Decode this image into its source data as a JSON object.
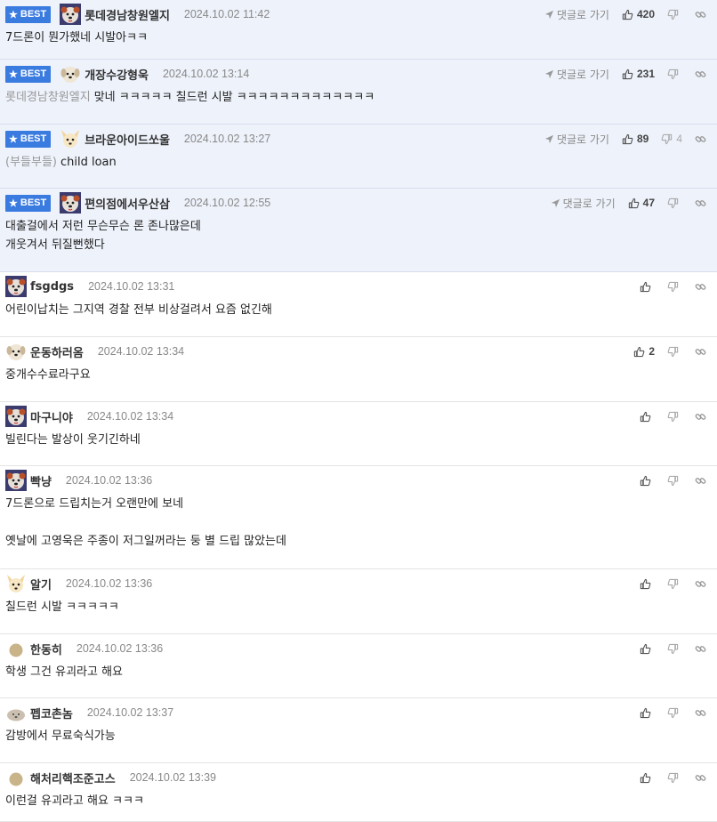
{
  "ui": {
    "best_label": "BEST",
    "reply_label": "댓글로 가기"
  },
  "colors": {
    "best_bg": "#eef2fb",
    "badge": "#3a7be0"
  },
  "comments": [
    {
      "best": true,
      "avatar": "dog-face-avatar",
      "nick": "롯데경남창원엘지",
      "date": "2024.10.02 11:42",
      "likes": "420",
      "dislikes": "",
      "mention": "",
      "lines": [
        "7드론이 뭔가했네 시발아ㅋㅋ"
      ]
    },
    {
      "best": true,
      "avatar": "puppy-avatar",
      "nick": "개장수강형욱",
      "date": "2024.10.02 13:14",
      "likes": "231",
      "dislikes": "",
      "mention": "롯데경남창원엘지",
      "lines": [
        "맞네 ㅋㅋㅋㅋㅋ 칠드런 시발 ㅋㅋㅋㅋㅋㅋㅋㅋㅋㅋㅋㅋㅋ"
      ]
    },
    {
      "best": true,
      "avatar": "fox-avatar",
      "nick": "브라운아이드쏘울",
      "date": "2024.10.02 13:27",
      "likes": "89",
      "dislikes": "4",
      "mention": "(부들부들)",
      "lines": [
        "child loan"
      ]
    },
    {
      "best": true,
      "avatar": "dog-face-avatar",
      "nick": "편의점에서우산삼",
      "date": "2024.10.02 12:55",
      "likes": "47",
      "dislikes": "",
      "mention": "",
      "lines": [
        "대출걸에서 저런 무슨무슨 론 존나많은데",
        "개웃겨서 뒤질뻔했다"
      ]
    },
    {
      "best": false,
      "avatar": "dog-face-avatar",
      "nick": "fsgdgs",
      "date": "2024.10.02 13:31",
      "likes": "",
      "dislikes": "",
      "mention": "",
      "lines": [
        "어린이납치는 그지역 경찰 전부 비상걸려서 요즘 없긴해"
      ]
    },
    {
      "best": false,
      "avatar": "puppy-avatar",
      "nick": "운동하러옴",
      "date": "2024.10.02 13:34",
      "likes": "2",
      "dislikes": "",
      "mention": "",
      "lines": [
        "중개수수료라구요"
      ]
    },
    {
      "best": false,
      "avatar": "dog-face-avatar",
      "nick": "마구니야",
      "date": "2024.10.02 13:34",
      "likes": "",
      "dislikes": "",
      "mention": "",
      "lines": [
        "빌린다는 발상이 웃기긴하네"
      ]
    },
    {
      "best": false,
      "avatar": "dog-face-avatar",
      "nick": "빡냥",
      "date": "2024.10.02 13:36",
      "likes": "",
      "dislikes": "",
      "mention": "",
      "lines": [
        "7드론으로 드립치는거 오랜만에 보네",
        "",
        "옛날에 고영욱은 주종이 저그일꺼라는 둥 별 드립 많았는데"
      ]
    },
    {
      "best": false,
      "avatar": "fox-avatar",
      "nick": "알기",
      "date": "2024.10.02 13:36",
      "likes": "",
      "dislikes": "",
      "mention": "",
      "lines": [
        "칠드런 시발 ㅋㅋㅋㅋㅋ"
      ]
    },
    {
      "best": false,
      "avatar": "brown-dot-avatar",
      "nick": "한동히",
      "date": "2024.10.02 13:36",
      "likes": "",
      "dislikes": "",
      "mention": "",
      "lines": [
        "학생 그건 유괴라고 해요"
      ]
    },
    {
      "best": false,
      "avatar": "mole-avatar",
      "nick": "펩코촌놈",
      "date": "2024.10.02 13:37",
      "likes": "",
      "dislikes": "",
      "mention": "",
      "lines": [
        "감방에서 무료숙식가능"
      ]
    },
    {
      "best": false,
      "avatar": "brown-dot-avatar",
      "nick": "해처리핵조준고스",
      "date": "2024.10.02 13:39",
      "likes": "",
      "dislikes": "",
      "mention": "",
      "lines": [
        "이런걸 유괴라고 해요 ㅋㅋㅋ"
      ]
    }
  ]
}
